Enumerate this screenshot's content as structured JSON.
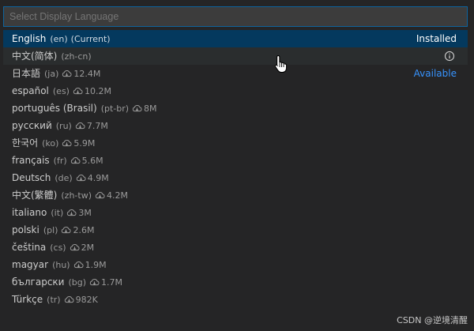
{
  "search": {
    "placeholder": "Select Display Language"
  },
  "languages": [
    {
      "name": "English",
      "code": "(en)",
      "extra": "(Current)",
      "status": "Installed"
    },
    {
      "name": "中文(简体)",
      "code": "(zh-cn)"
    },
    {
      "name": "日本語",
      "code": "(ja)",
      "size": "12.4M",
      "status": "Available"
    },
    {
      "name": "español",
      "code": "(es)",
      "size": "10.2M"
    },
    {
      "name": "português (Brasil)",
      "code": "(pt-br)",
      "size": "8M"
    },
    {
      "name": "русский",
      "code": "(ru)",
      "size": "7.7M"
    },
    {
      "name": "한국어",
      "code": "(ko)",
      "size": "5.9M"
    },
    {
      "name": "français",
      "code": "(fr)",
      "size": "5.6M"
    },
    {
      "name": "Deutsch",
      "code": "(de)",
      "size": "4.9M"
    },
    {
      "name": "中文(繁體)",
      "code": "(zh-tw)",
      "size": "4.2M"
    },
    {
      "name": "italiano",
      "code": "(it)",
      "size": "3M"
    },
    {
      "name": "polski",
      "code": "(pl)",
      "size": "2.6M"
    },
    {
      "name": "čeština",
      "code": "(cs)",
      "size": "2M"
    },
    {
      "name": "magyar",
      "code": "(hu)",
      "size": "1.9M"
    },
    {
      "name": "български",
      "code": "(bg)",
      "size": "1.7M"
    },
    {
      "name": "Türkçe",
      "code": "(tr)",
      "size": "982K"
    }
  ],
  "icons": {
    "download": "cloud-download-icon",
    "info": "info-icon",
    "cursor": "hand-pointer-icon"
  },
  "colors": {
    "selected_bg": "#04395e",
    "focus_border": "#0e639c",
    "available": "#3794ff"
  },
  "watermark": "CSDN @逆境清醒"
}
